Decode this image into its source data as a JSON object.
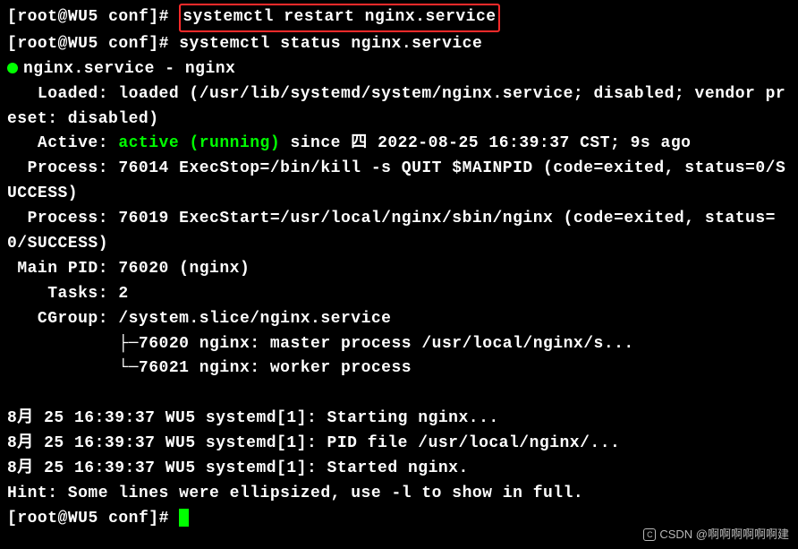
{
  "prompt": {
    "user": "root",
    "host": "WU5",
    "dir": "conf",
    "symbol": "#"
  },
  "commands": {
    "restart": "systemctl restart nginx.service",
    "status": "systemctl status nginx.service"
  },
  "status": {
    "unit_name": "nginx.service",
    "unit_desc": "nginx",
    "loaded_line": "   Loaded: loaded (/usr/lib/systemd/system/nginx.service; disabled; vendor preset: disabled)",
    "active_prefix": "   Active: ",
    "active_state": "active (running)",
    "active_suffix": " since 四 2022-08-25 16:39:37 CST; 9s ago",
    "process1": "  Process: 76014 ExecStop=/bin/kill -s QUIT $MAINPID (code=exited, status=0/SUCCESS)",
    "process2": "  Process: 76019 ExecStart=/usr/local/nginx/sbin/nginx (code=exited, status=0/SUCCESS)",
    "main_pid": " Main PID: 76020 (nginx)",
    "tasks": "    Tasks: 2",
    "cgroup": "   CGroup: /system.slice/nginx.service",
    "cgroup_child1": "           ├─76020 nginx: master process /usr/local/nginx/s...",
    "cgroup_child2": "           └─76021 nginx: worker process"
  },
  "logs": {
    "l1": "8月 25 16:39:37 WU5 systemd[1]: Starting nginx...",
    "l2": "8月 25 16:39:37 WU5 systemd[1]: PID file /usr/local/nginx/...",
    "l3": "8月 25 16:39:37 WU5 systemd[1]: Started nginx.",
    "hint": "Hint: Some lines were ellipsized, use -l to show in full."
  },
  "watermark": "CSDN @啊啊啊啊啊啊建"
}
